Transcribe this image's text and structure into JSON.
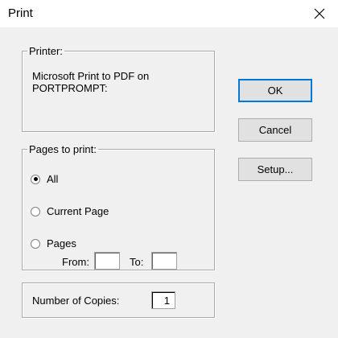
{
  "window": {
    "title": "Print",
    "close_icon": "close-icon"
  },
  "printer": {
    "legend": "Printer:",
    "name_line1": "Microsoft Print to PDF on",
    "name_line2": "PORTPROMPT:"
  },
  "pages": {
    "legend": "Pages to print:",
    "options": [
      {
        "label": "All",
        "selected": true
      },
      {
        "label": "Current Page",
        "selected": false
      },
      {
        "label": "Pages",
        "selected": false
      }
    ],
    "from_label": "From:",
    "to_label": "To:",
    "from_value": "",
    "to_value": ""
  },
  "copies": {
    "label": "Number of Copies:",
    "value": "1"
  },
  "buttons": {
    "ok": "OK",
    "cancel": "Cancel",
    "setup": "Setup..."
  },
  "colors": {
    "dialog_bg": "#f0f0f0",
    "button_bg": "#e1e1e1",
    "default_border": "#0078d7"
  }
}
